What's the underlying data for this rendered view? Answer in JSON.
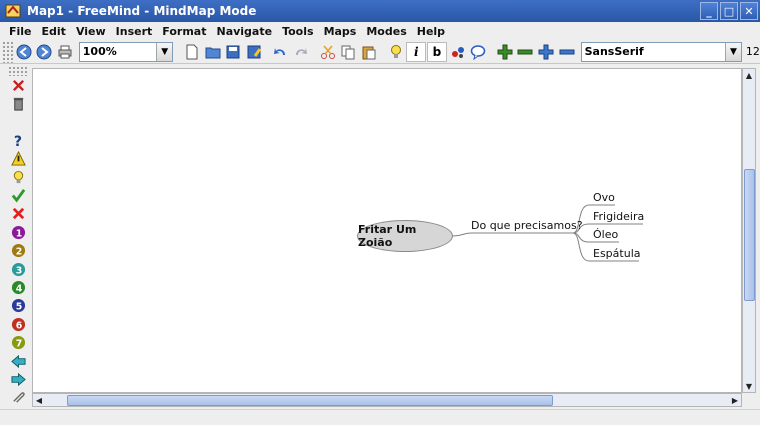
{
  "window": {
    "title": "Map1 - FreeMind - MindMap Mode",
    "controls": [
      "minimize",
      "maximize",
      "close"
    ]
  },
  "menu": [
    {
      "label": "File"
    },
    {
      "label": "Edit"
    },
    {
      "label": "View"
    },
    {
      "label": "Insert"
    },
    {
      "label": "Format"
    },
    {
      "label": "Navigate"
    },
    {
      "label": "Tools"
    },
    {
      "label": "Maps"
    },
    {
      "label": "Modes"
    },
    {
      "label": "Help"
    }
  ],
  "toolbar": {
    "zoom_value": "100%",
    "font_family": "SansSerif",
    "font_size": "12",
    "italic_label": "i",
    "bold_label": "b"
  },
  "mindmap": {
    "root": "Fritar Um Zoião",
    "child": "Do que precisamos?",
    "leaves": [
      "Ovo",
      "Frigideira",
      "Óleo",
      "Espátula"
    ]
  },
  "colors": {
    "titlebar": "#2a57a8",
    "node_fill": "#d6d6d6",
    "edge": "#808080"
  },
  "icons": {
    "left_toolbar": [
      "remove-first-icon",
      "remove-all-icon",
      "question-icon",
      "warning-icon",
      "idea-icon",
      "ok-icon",
      "not-ok-icon",
      "priority-1-icon",
      "priority-2-icon",
      "priority-3-icon",
      "priority-4-icon",
      "priority-5-icon",
      "priority-6-icon",
      "priority-7-icon",
      "back-icon",
      "forward-icon",
      "attach-icon"
    ]
  }
}
